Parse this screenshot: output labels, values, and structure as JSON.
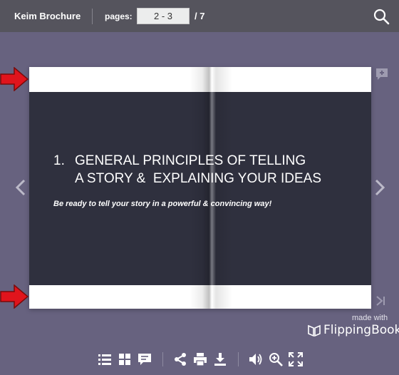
{
  "header": {
    "title": "Keim Brochure",
    "pages_label": "pages:",
    "pages_value": "2 - 3",
    "pages_total": "/ 7"
  },
  "page_content": {
    "heading_number": "1.",
    "heading_line1": "GENERAL PRINCIPLES OF TELLING",
    "heading_line2": "A STORY &  EXPLAINING YOUR IDEAS",
    "subline": "Be ready to tell your story in a powerful & convincing way!"
  },
  "branding": {
    "made_with": "made with",
    "name": "FlippingBook"
  },
  "colors": {
    "background": "#67627f",
    "topbar": "#55545d",
    "dark_panel": "#2f303e",
    "annotation_arrow": "#e0141c"
  },
  "icons": {
    "search": "search-icon",
    "prev": "chevron-left-icon",
    "next": "chevron-right-icon",
    "add_note": "add-note-icon",
    "last_page": "last-page-icon",
    "toolbar": [
      "table-of-contents-icon",
      "thumbnails-icon",
      "notes-icon",
      "share-icon",
      "print-icon",
      "download-icon",
      "sound-icon",
      "zoom-in-icon",
      "fullscreen-icon"
    ]
  }
}
